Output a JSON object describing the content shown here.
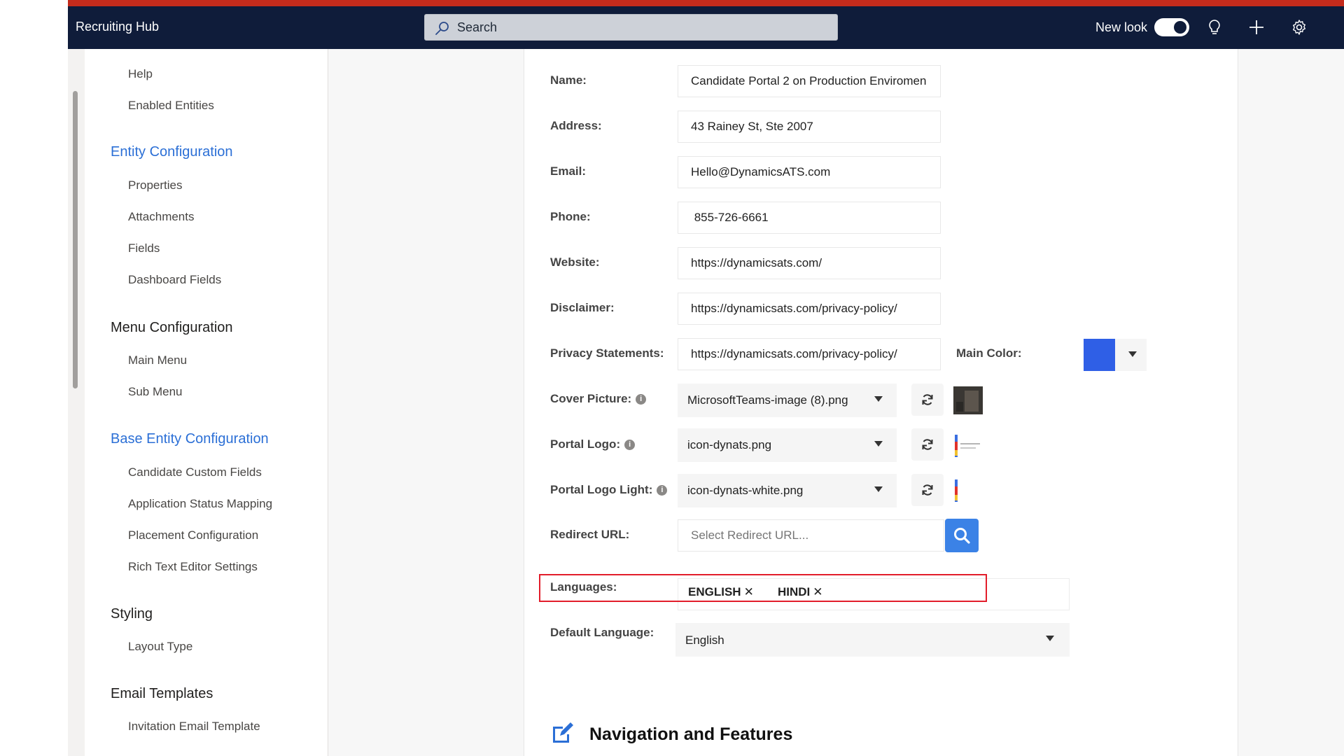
{
  "app": {
    "title": "Recruiting Hub",
    "search_placeholder": "Search",
    "new_look_label": "New look",
    "new_look_enabled": true,
    "icons": [
      "search-icon",
      "lightbulb-icon",
      "plus-icon",
      "gear-icon"
    ]
  },
  "sidebar": {
    "top_items": [
      "Help",
      "Enabled Entities"
    ],
    "groups": [
      {
        "title": "Entity Configuration",
        "active": true,
        "items": [
          "Properties",
          "Attachments",
          "Fields",
          "Dashboard Fields"
        ]
      },
      {
        "title": "Menu Configuration",
        "active": false,
        "items": [
          "Main Menu",
          "Sub Menu"
        ]
      },
      {
        "title": "Base Entity Configuration",
        "active": true,
        "items": [
          "Candidate Custom Fields",
          "Application Status Mapping",
          "Placement Configuration",
          "Rich Text Editor Settings"
        ]
      },
      {
        "title": "Styling",
        "active": false,
        "items": [
          "Layout Type"
        ]
      },
      {
        "title": "Email Templates",
        "active": false,
        "items": [
          "Invitation Email Template"
        ]
      }
    ]
  },
  "form": {
    "name": {
      "label": "Name:",
      "value": "Candidate Portal 2 on Production Enviromen"
    },
    "address": {
      "label": "Address:",
      "value": "43 Rainey St, Ste 2007"
    },
    "email": {
      "label": "Email:",
      "value": "Hello@DynamicsATS.com"
    },
    "phone": {
      "label": "Phone:",
      "value": " 855-726-6661"
    },
    "website": {
      "label": "Website:",
      "value": "https://dynamicsats.com/"
    },
    "disclaimer": {
      "label": "Disclaimer:",
      "value": "https://dynamicsats.com/privacy-policy/"
    },
    "privacy": {
      "label": "Privacy Statements:",
      "value": "https://dynamicsats.com/privacy-policy/"
    },
    "main_color": {
      "label": "Main Color:",
      "color": "#2f5fe6"
    },
    "cover_picture": {
      "label": "Cover Picture:",
      "value": "MicrosoftTeams-image (8).png"
    },
    "portal_logo": {
      "label": "Portal Logo:",
      "value": "icon-dynats.png"
    },
    "portal_logo_light": {
      "label": "Portal Logo Light:",
      "value": "icon-dynats-white.png"
    },
    "redirect_url": {
      "label": "Redirect URL:",
      "placeholder": "Select Redirect URL..."
    },
    "languages": {
      "label": "Languages:",
      "chips": [
        "ENGLISH",
        "HINDI"
      ],
      "remove_glyph": "✕"
    },
    "default_language": {
      "label": "Default Language:",
      "value": "English"
    }
  },
  "section": {
    "title": "Navigation and Features",
    "icon": "edit-icon"
  },
  "colors": {
    "accent": "#2b6fd6",
    "topbar": "#0f1c3a",
    "alert_bar": "#c42b1c",
    "highlight": "#e21d2b",
    "search_button": "#3b82e6"
  }
}
